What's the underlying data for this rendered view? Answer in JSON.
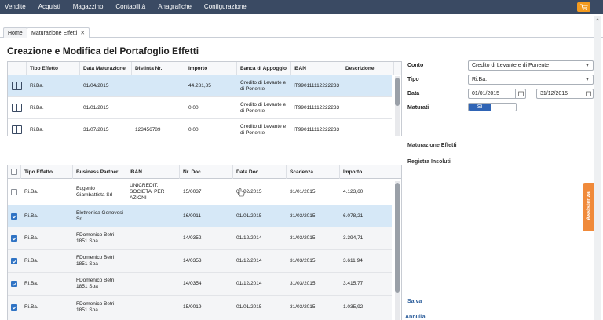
{
  "nav": {
    "items": [
      "Vendite",
      "Acquisti",
      "Magazzino",
      "Contabilità",
      "Anagrafiche",
      "Configurazione"
    ],
    "cart_icon": "cart-icon",
    "accent": "#f39a1e"
  },
  "tabs": [
    {
      "label": "Home"
    },
    {
      "label": "Maturazione Effetti",
      "close": "✕"
    }
  ],
  "page_title": "Creazione e Modifica del Portafoglio Effetti",
  "portfolio_table": {
    "headers": [
      "Tipo Effetto",
      "Data Maturazione",
      "Distinta Nr.",
      "Importo",
      "Banca di Appoggio",
      "IBAN",
      "Descrizione"
    ],
    "rows": [
      {
        "tipo": "Ri.Ba.",
        "data": "01/04/2015",
        "distinta": "",
        "importo": "44.281,85",
        "banca": "Credito di Levante e di Ponente",
        "iban": "IT990111112222233",
        "descrizione": ""
      },
      {
        "tipo": "Ri.Ba.",
        "data": "01/01/2015",
        "distinta": "",
        "importo": "0,00",
        "banca": "Credito di Levante e di Ponente",
        "iban": "IT990111112222233",
        "descrizione": ""
      },
      {
        "tipo": "Ri.Ba.",
        "data": "31/07/2015",
        "distinta": "123456789",
        "importo": "0,00",
        "banca": "Credito di Levante e di Ponente",
        "iban": "IT990111112222233",
        "descrizione": ""
      }
    ]
  },
  "effects_table": {
    "headers": [
      "Tipo Effetto",
      "Business Partner",
      "IBAN",
      "Nr. Doc.",
      "Data Doc.",
      "Scadenza",
      "Importo"
    ],
    "rows": [
      {
        "checked": false,
        "tipo": "Ri.Ba.",
        "partner": "Eugenio Giambattista Srl",
        "iban": "UNICREDIT, SOCIETA' PER AZIONI",
        "nr": "15/0037",
        "data": "01/02/2015",
        "scadenza": "31/01/2015",
        "importo": "4.123,60"
      },
      {
        "checked": true,
        "tipo": "Ri.Ba.",
        "partner": "Elettronica Genovesi Srl",
        "iban": "",
        "nr": "16/0011",
        "data": "01/01/2015",
        "scadenza": "31/03/2015",
        "importo": "6.078,21"
      },
      {
        "checked": true,
        "tipo": "Ri.Ba.",
        "partner": "FDomenico Betri 1851 Spa",
        "iban": "",
        "nr": "14/0352",
        "data": "01/12/2014",
        "scadenza": "31/03/2015",
        "importo": "3.394,71"
      },
      {
        "checked": true,
        "tipo": "Ri.Ba.",
        "partner": "FDomenico Betri 1851 Spa",
        "iban": "",
        "nr": "14/0353",
        "data": "01/12/2014",
        "scadenza": "31/03/2015",
        "importo": "3.611,94"
      },
      {
        "checked": true,
        "tipo": "Ri.Ba.",
        "partner": "FDomenico Betri 1851 Spa",
        "iban": "",
        "nr": "14/0354",
        "data": "01/12/2014",
        "scadenza": "31/03/2015",
        "importo": "3.415,77"
      },
      {
        "checked": true,
        "tipo": "Ri.Ba.",
        "partner": "FDomenico Betri 1851 Spa",
        "iban": "",
        "nr": "15/0019",
        "data": "01/01/2015",
        "scadenza": "31/03/2015",
        "importo": "1.035,92"
      }
    ]
  },
  "form": {
    "conto_label": "Conto",
    "conto_value": "Credito di Levante e di Ponente",
    "tipo_label": "Tipo",
    "tipo_value": "Ri.Ba.",
    "data_label": "Data",
    "data_from": "01/01/2015",
    "data_to": "31/12/2015",
    "maturati_label": "Maturati",
    "maturati_value": "Sì"
  },
  "actions": {
    "maturazione": "Maturazione Effetti",
    "registra": "Registra Insoluti",
    "salva": "Salva",
    "annulla": "Annulla"
  },
  "assistenza": "Assistenza"
}
